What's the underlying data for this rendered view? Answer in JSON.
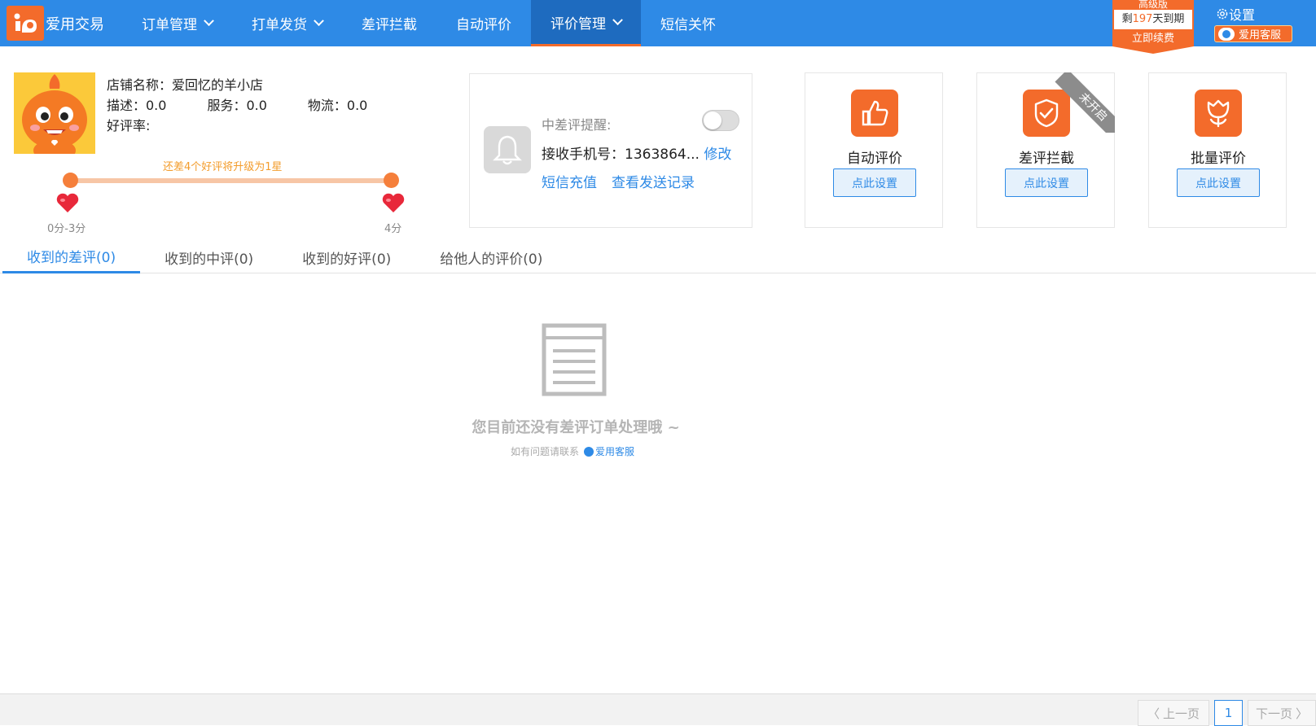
{
  "app": {
    "logo_text": "爱用交易"
  },
  "nav": [
    {
      "label": "订单管理",
      "dropdown": true
    },
    {
      "label": "打单发货",
      "dropdown": true
    },
    {
      "label": "差评拦截",
      "dropdown": false
    },
    {
      "label": "自动评价",
      "dropdown": false
    },
    {
      "label": "评价管理",
      "dropdown": true,
      "active": true
    },
    {
      "label": "短信关怀",
      "dropdown": false
    }
  ],
  "version": {
    "tier": "高级版",
    "remain_prefix": "剩",
    "remain_days": "197",
    "remain_suffix": "天到期",
    "renew": "立即续费"
  },
  "header": {
    "settings": "设置",
    "service": "爱用客服"
  },
  "shop": {
    "name_label": "店铺名称：",
    "name": "爱回忆的羊小店",
    "desc": "描述：0.0",
    "service": "服务：0.0",
    "logistics": "物流：0.0",
    "good_rate": "好评率:",
    "upgrade_tip": "还差4个好评将升级为1星",
    "start_label": "0分-3分",
    "end_label": "4分",
    "progress": 1.0
  },
  "reminder": {
    "title": "中差评提醒:",
    "toggle_on": false,
    "phone_label": "接收手机号：",
    "phone": "1363864...",
    "edit": "修改",
    "recharge": "短信充值",
    "history": "查看发送记录"
  },
  "features": [
    {
      "label": "自动评价",
      "button": "点此设置",
      "icon": "thumbs-up-icon"
    },
    {
      "label": "差评拦截",
      "button": "点此设置",
      "icon": "shield-check-icon",
      "ribbon": "未开启"
    },
    {
      "label": "批量评价",
      "button": "点此设置",
      "icon": "tulip-icon"
    }
  ],
  "tabs": [
    {
      "label": "收到的差评(0)",
      "active": true
    },
    {
      "label": "收到的中评(0)"
    },
    {
      "label": "收到的好评(0)"
    },
    {
      "label": "给他人的评价(0)"
    }
  ],
  "empty": {
    "title": "您目前还没有差评订单处理哦 ~",
    "contact": "如有问题请联系",
    "service": "爱用客服"
  },
  "pager": {
    "prev": "上一页",
    "current": "1",
    "next": "下一页"
  },
  "colors": {
    "primary": "#2e8ae6",
    "accent": "#f36b2b"
  }
}
